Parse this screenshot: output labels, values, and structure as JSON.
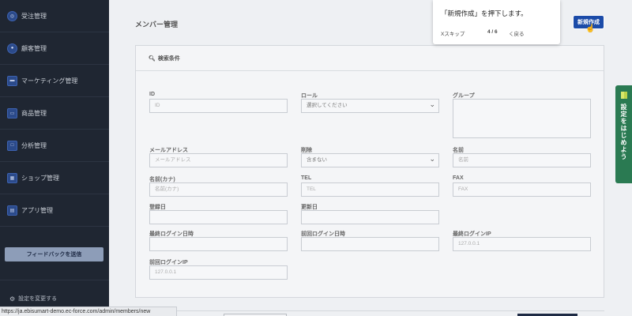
{
  "sidebar": {
    "items": [
      {
        "label": "受注管理",
        "icon": "order-icon"
      },
      {
        "label": "顧客管理",
        "icon": "customer-icon"
      },
      {
        "label": "マーケティング管理",
        "icon": "marketing-icon"
      },
      {
        "label": "商品管理",
        "icon": "product-icon"
      },
      {
        "label": "分析管理",
        "icon": "analytics-icon"
      },
      {
        "label": "ショップ管理",
        "icon": "shop-icon"
      },
      {
        "label": "アプリ管理",
        "icon": "app-icon"
      }
    ],
    "feedback_label": "フィードバックを送信",
    "settings_label": "設定を変更する"
  },
  "status_bar": {
    "url": "https://ja.ebisumart-demo.ec-force.com/admin/members/new"
  },
  "header": {
    "title": "メンバー管理",
    "new_button": "新規作成"
  },
  "search": {
    "title": "検索条件",
    "fields": {
      "id": {
        "label": "ID",
        "placeholder": "ID"
      },
      "role": {
        "label": "ロール",
        "value": "選択してください"
      },
      "group": {
        "label": "グループ"
      },
      "email": {
        "label": "メールアドレス",
        "placeholder": "メールアドレス"
      },
      "deleted": {
        "label": "削除",
        "value": "含まない"
      },
      "name": {
        "label": "名前",
        "placeholder": "名前"
      },
      "name_kana": {
        "label": "名前(カナ)",
        "placeholder": "名前(カナ)"
      },
      "tel": {
        "label": "TEL",
        "placeholder": "TEL"
      },
      "fax": {
        "label": "FAX",
        "placeholder": "FAX"
      },
      "registered": {
        "label": "登録日"
      },
      "updated": {
        "label": "更新日"
      },
      "last_login": {
        "label": "最終ログイン日時"
      },
      "prev_login": {
        "label": "前回ログイン日時"
      },
      "last_ip": {
        "label": "最終ログインIP",
        "placeholder": "127.0.0.1"
      },
      "prev_ip": {
        "label": "前回ログインIP",
        "placeholder": "127.0.0.1"
      }
    }
  },
  "tooltip": {
    "text": "「新規作成」を押下します。",
    "skip": "Xスキップ",
    "count": "4 / 6",
    "back": "く戻る"
  },
  "side_tab": {
    "label": "設定をはじめよう"
  },
  "colors": {
    "sidebar": "#1f2632",
    "primary": "#1b4ba8",
    "side_tab": "#2a7a52"
  }
}
